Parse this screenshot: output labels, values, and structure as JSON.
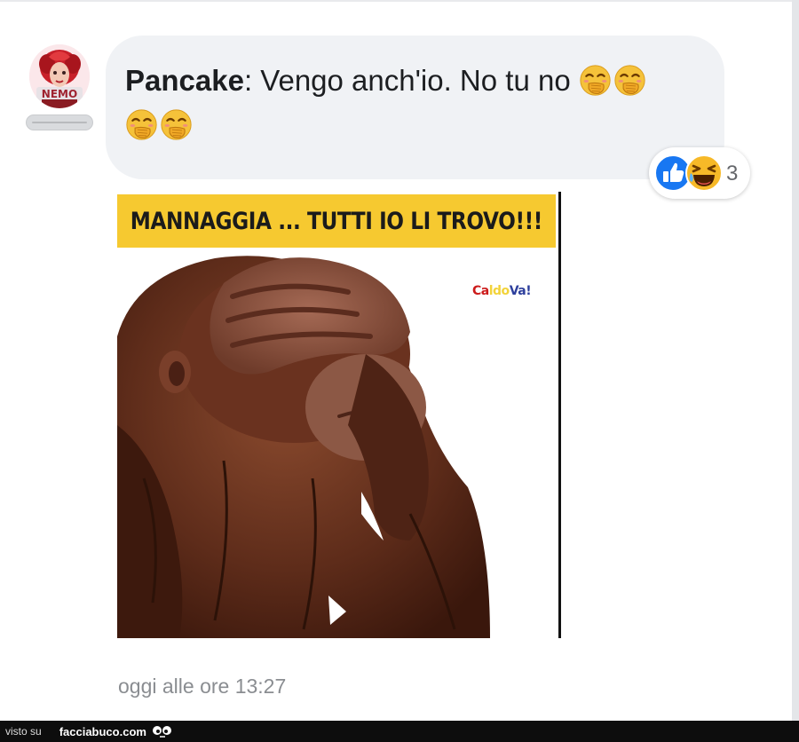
{
  "comment": {
    "author": "Pancake",
    "separator": ":",
    "text": " Vengo anch'io. No tu no ",
    "emoji_name": "face-with-hand-over-mouth-emoji"
  },
  "reactions": {
    "types": [
      "like",
      "haha"
    ],
    "count": "3"
  },
  "meme": {
    "banner": "MANNAGGIA ... TUTTI IO LI TROVO!!!",
    "watermark_1": "Ca",
    "watermark_2": "ldo",
    "watermark_3": "Va!"
  },
  "timestamp": "oggi alle ore 13:27",
  "footer": {
    "prefix": "visto su",
    "brand": "facciabuco.com"
  },
  "colors": {
    "bubble": "#f0f2f5",
    "text": "#1c1e21",
    "like_blue": "#1877f2",
    "banner_yellow": "#f6c930",
    "timestamp": "#8a8d91"
  }
}
